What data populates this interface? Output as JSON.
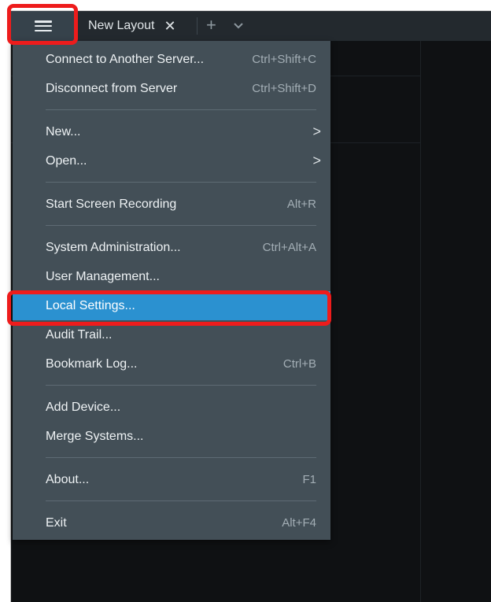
{
  "titlebar": {
    "tab_label": "New Layout",
    "tab_close": "✕",
    "tab_add": "+",
    "main_menu_icon": "hamburger-menu-icon",
    "tab_more_icon": "chevron-down-icon"
  },
  "menu": {
    "connect": {
      "label": "Connect to Another Server...",
      "shortcut": "Ctrl+Shift+C"
    },
    "disconnect": {
      "label": "Disconnect from Server",
      "shortcut": "Ctrl+Shift+D"
    },
    "new": {
      "label": "New...",
      "arrow": ">"
    },
    "open": {
      "label": "Open...",
      "arrow": ">"
    },
    "recording": {
      "label": "Start Screen Recording",
      "shortcut": "Alt+R"
    },
    "sysadmin": {
      "label": "System Administration...",
      "shortcut": "Ctrl+Alt+A"
    },
    "users": {
      "label": "User Management..."
    },
    "local_settings": {
      "label": "Local Settings..."
    },
    "audit": {
      "label": "Audit Trail..."
    },
    "bookmarks": {
      "label": "Bookmark Log...",
      "shortcut": "Ctrl+B"
    },
    "add_device": {
      "label": "Add Device..."
    },
    "merge": {
      "label": "Merge Systems..."
    },
    "about": {
      "label": "About...",
      "shortcut": "F1"
    },
    "exit": {
      "label": "Exit",
      "shortcut": "Alt+F4"
    }
  },
  "colors": {
    "highlight": "#ee1c1c",
    "menu_bg": "#434f57",
    "active_item": "#2b91d0"
  }
}
